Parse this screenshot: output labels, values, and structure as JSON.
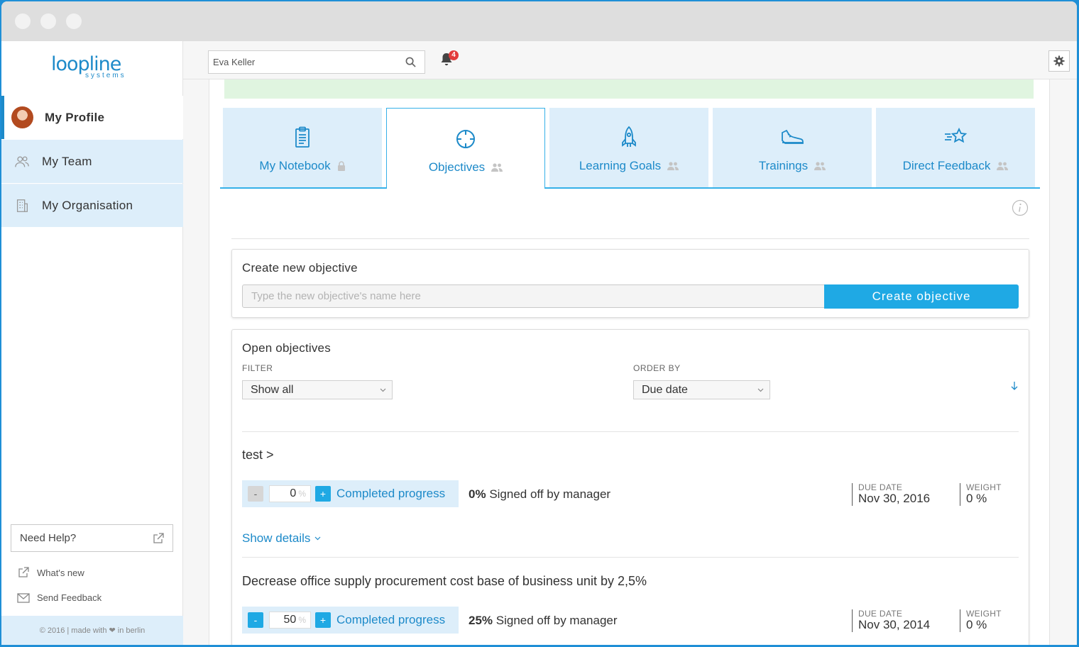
{
  "brand": {
    "logo_text": "loopline",
    "logo_sub": "systems"
  },
  "sidebar": {
    "items": [
      {
        "label": "My Profile",
        "icon": "avatar",
        "active": true
      },
      {
        "label": "My Team",
        "icon": "team-icon",
        "active": false
      },
      {
        "label": "My Organisation",
        "icon": "building-icon",
        "active": false
      }
    ],
    "help_label": "Need Help?",
    "whats_new": "What's new",
    "send_feedback": "Send Feedback",
    "footer": "© 2016 | made with ❤ in berlin"
  },
  "topbar": {
    "search_value": "Eva Keller",
    "notification_count": "4"
  },
  "tabs": [
    {
      "label": "My Notebook",
      "icon": "clipboard-icon",
      "badge_icon": "lock-icon"
    },
    {
      "label": "Objectives",
      "icon": "crosshair-icon",
      "badge_icon": "people-icon"
    },
    {
      "label": "Learning Goals",
      "icon": "rocket-icon",
      "badge_icon": "people-icon"
    },
    {
      "label": "Trainings",
      "icon": "sneaker-icon",
      "badge_icon": "people-icon"
    },
    {
      "label": "Direct Feedback",
      "icon": "star-icon",
      "badge_icon": "people-icon"
    }
  ],
  "create": {
    "title": "Create new objective",
    "placeholder": "Type the new objective's name here",
    "button": "Create objective"
  },
  "open": {
    "title": "Open objectives",
    "filter_label": "FILTER",
    "filter_value": "Show all",
    "order_label": "ORDER BY",
    "order_value": "Due date"
  },
  "objectives": [
    {
      "title": "test >",
      "progress": "0",
      "pct_sign": "%",
      "completed_label": "Completed progress",
      "signed_pct": "0%",
      "signed_text": "Signed off by manager",
      "due_label": "DUE DATE",
      "due": "Nov 30, 2016",
      "weight_label": "WEIGHT",
      "weight": "0 %",
      "show_details": "Show details"
    },
    {
      "title": "Decrease office supply procurement cost base of business unit by 2,5%",
      "progress": "50",
      "pct_sign": "%",
      "completed_label": "Completed progress",
      "signed_pct": "25%",
      "signed_text": "Signed off by manager",
      "due_label": "DUE DATE",
      "due": "Nov 30, 2014",
      "weight_label": "WEIGHT",
      "weight": "0 %"
    }
  ],
  "colors": {
    "accent": "#1fa9e4",
    "link": "#1d8ac9",
    "tab_bg": "#ddeefa",
    "success": "#e0f5e0"
  }
}
